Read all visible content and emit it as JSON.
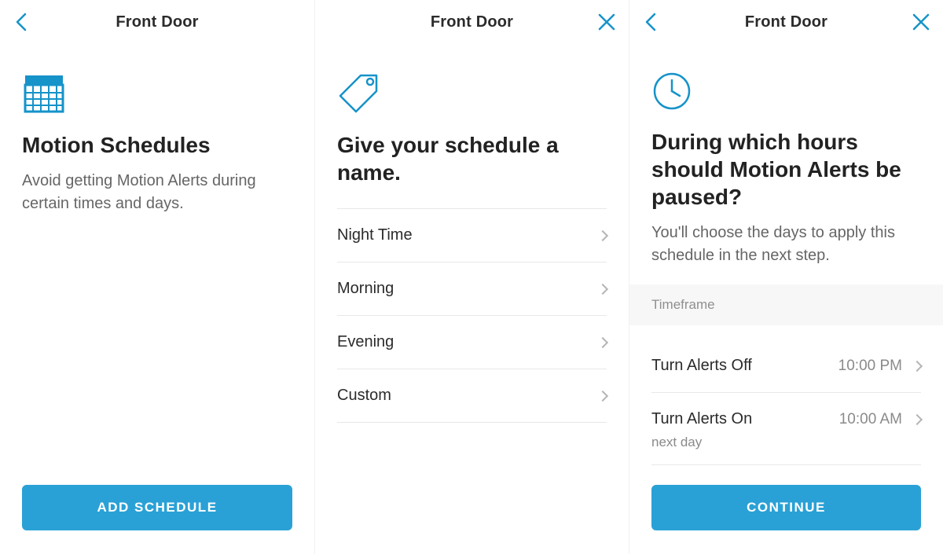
{
  "screens": {
    "overview": {
      "title": "Front Door",
      "heading": "Motion Schedules",
      "subtext": "Avoid getting Motion Alerts during certain times and days.",
      "add_button": "ADD SCHEDULE"
    },
    "name": {
      "title": "Front Door",
      "heading": "Give your schedule a name.",
      "options": {
        "night": "Night Time",
        "morning": "Morning",
        "evening": "Evening",
        "custom": "Custom"
      }
    },
    "hours": {
      "title": "Front Door",
      "heading": "During which hours should Motion Alerts be paused?",
      "subtext": "You'll choose the days to apply this schedule in the next step.",
      "section": "Timeframe",
      "off_label": "Turn Alerts Off",
      "off_value": "10:00 PM",
      "on_label": "Turn Alerts On",
      "on_value": "10:00 AM",
      "on_sub": "next day",
      "continue_button": "CONTINUE"
    }
  }
}
